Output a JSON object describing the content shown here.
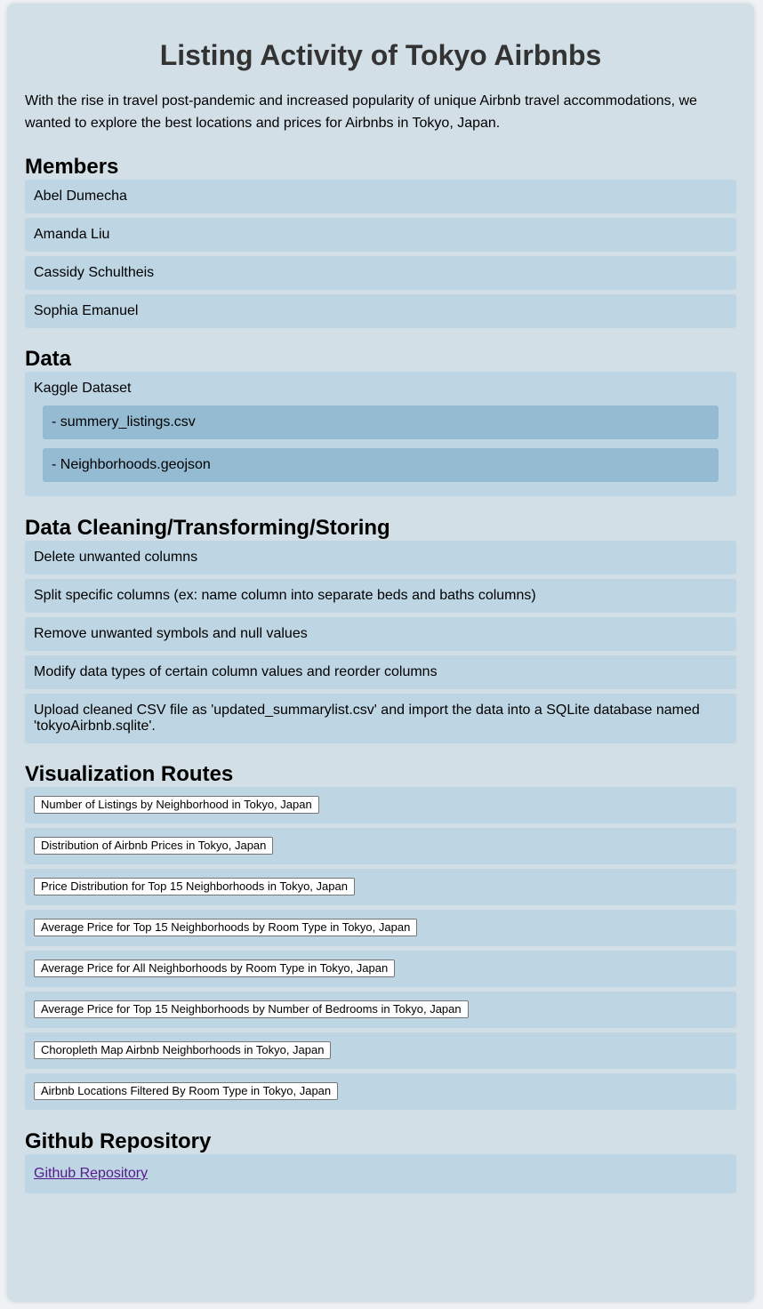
{
  "page": {
    "title": "Listing Activity of Tokyo Airbnbs",
    "intro": "With the rise in travel post-pandemic and increased popularity of unique Airbnb travel accommodations, we wanted to explore the best locations and prices for Airbnbs in Tokyo, Japan."
  },
  "members": {
    "heading": "Members",
    "items": [
      "Abel Dumecha",
      "Amanda Liu",
      "Cassidy Schultheis",
      "Sophia Emanuel"
    ]
  },
  "data": {
    "heading": "Data",
    "source": "Kaggle Dataset",
    "files": [
      "- summery_listings.csv",
      "- Neighborhoods.geojson"
    ]
  },
  "cleaning": {
    "heading": "Data Cleaning/Transforming/Storing",
    "steps": [
      "Delete unwanted columns",
      "Split specific columns (ex: name column into separate beds and baths columns)",
      "Remove unwanted symbols and null values",
      "Modify data types of certain column values and reorder columns",
      "Upload cleaned CSV file as 'updated_summarylist.csv' and import the data into a SQLite database named 'tokyoAirbnb.sqlite'."
    ]
  },
  "routes": {
    "heading": "Visualization Routes",
    "buttons": [
      "Number of Listings by Neighborhood in Tokyo, Japan",
      "Distribution of Airbnb Prices in Tokyo, Japan",
      "Price Distribution for Top 15 Neighborhoods in Tokyo, Japan",
      "Average Price for Top 15 Neighborhoods by Room Type in Tokyo, Japan",
      "Average Price for All Neighborhoods by Room Type in Tokyo, Japan",
      "Average Price for Top 15 Neighborhoods by Number of Bedrooms in Tokyo, Japan",
      "Choropleth Map Airbnb Neighborhoods in Tokyo, Japan",
      "Airbnb Locations Filtered By Room Type in Tokyo, Japan"
    ]
  },
  "github": {
    "heading": "Github Repository",
    "link_text": "Github Repository"
  },
  "colors": {
    "page_background": "#eff2f4",
    "card_background": "#d2dfe6",
    "item_background": "#bed5e3",
    "subitem_background": "#95bbd3",
    "title_color": "#333333",
    "link_color": "#551a8b"
  }
}
